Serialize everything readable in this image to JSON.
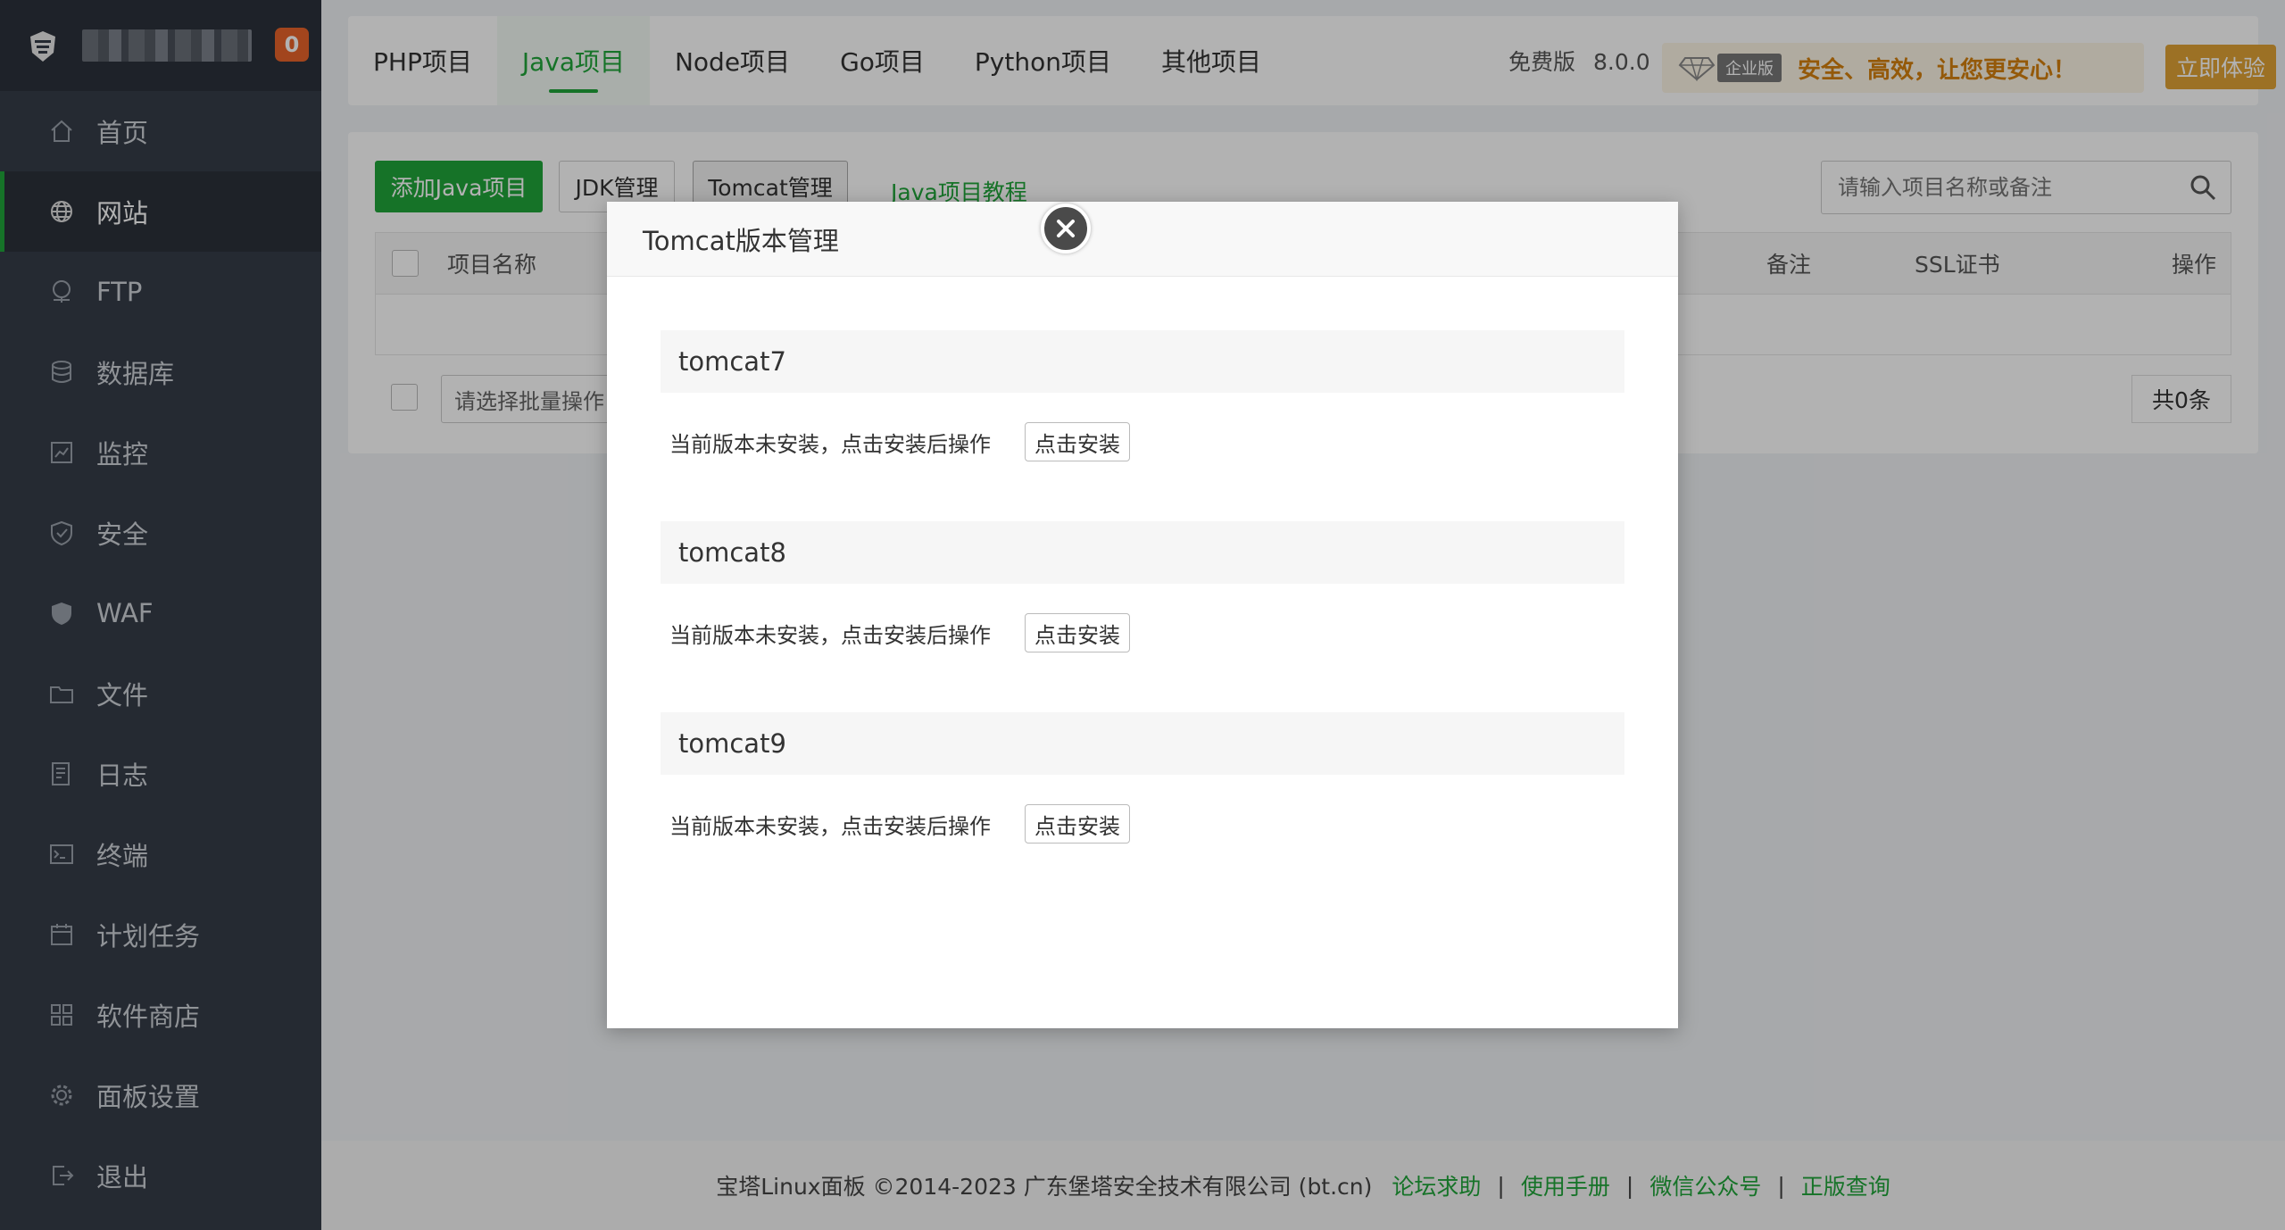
{
  "sidebar": {
    "badge_count": "0",
    "items": [
      {
        "label": "首页",
        "icon": "home-icon"
      },
      {
        "label": "网站",
        "icon": "globe-icon",
        "active": true
      },
      {
        "label": "FTP",
        "icon": "ftp-icon"
      },
      {
        "label": "数据库",
        "icon": "database-icon"
      },
      {
        "label": "监控",
        "icon": "monitor-icon"
      },
      {
        "label": "安全",
        "icon": "shield-check-icon"
      },
      {
        "label": "WAF",
        "icon": "shield-icon"
      },
      {
        "label": "文件",
        "icon": "folder-icon"
      },
      {
        "label": "日志",
        "icon": "log-icon"
      },
      {
        "label": "终端",
        "icon": "terminal-icon"
      },
      {
        "label": "计划任务",
        "icon": "calendar-icon"
      },
      {
        "label": "软件商店",
        "icon": "grid-icon"
      },
      {
        "label": "面板设置",
        "icon": "gear-icon"
      },
      {
        "label": "退出",
        "icon": "logout-icon"
      }
    ]
  },
  "topbar": {
    "tabs": [
      {
        "label": "PHP项目"
      },
      {
        "label": "Java项目",
        "active": true
      },
      {
        "label": "Node项目"
      },
      {
        "label": "Go项目"
      },
      {
        "label": "Python项目"
      },
      {
        "label": "其他项目"
      }
    ],
    "edition": "免费版",
    "version": "8.0.0",
    "enterprise_badge": "企业版",
    "promo_text": "安全、高效，让您更安心！",
    "try_button": "立即体验"
  },
  "panel": {
    "add_button": "添加Java项目",
    "jdk_button": "JDK管理",
    "tomcat_button": "Tomcat管理",
    "tutorial_link": "Java项目教程",
    "search_placeholder": "请输入项目名称或备注",
    "columns": {
      "name": "项目名称",
      "note": "备注",
      "ssl": "SSL证书",
      "op": "操作"
    },
    "batch_placeholder": "请选择批量操作",
    "total": "共0条"
  },
  "modal": {
    "title": "Tomcat版本管理",
    "versions": [
      {
        "name": "tomcat7",
        "status": "当前版本未安装，点击安装后操作",
        "button": "点击安装"
      },
      {
        "name": "tomcat8",
        "status": "当前版本未安装，点击安装后操作",
        "button": "点击安装"
      },
      {
        "name": "tomcat9",
        "status": "当前版本未安装，点击安装后操作",
        "button": "点击安装"
      }
    ]
  },
  "footer": {
    "copyright": "宝塔Linux面板 ©2014-2023 广东堡塔安全技术有限公司 (bt.cn)",
    "links": [
      "论坛求助",
      "使用手册",
      "微信公众号",
      "正版查询"
    ]
  },
  "colors": {
    "accent": "#20a53a",
    "sidebar_bg": "#363d48",
    "promo": "#d4800e",
    "badge": "#e8632a"
  }
}
